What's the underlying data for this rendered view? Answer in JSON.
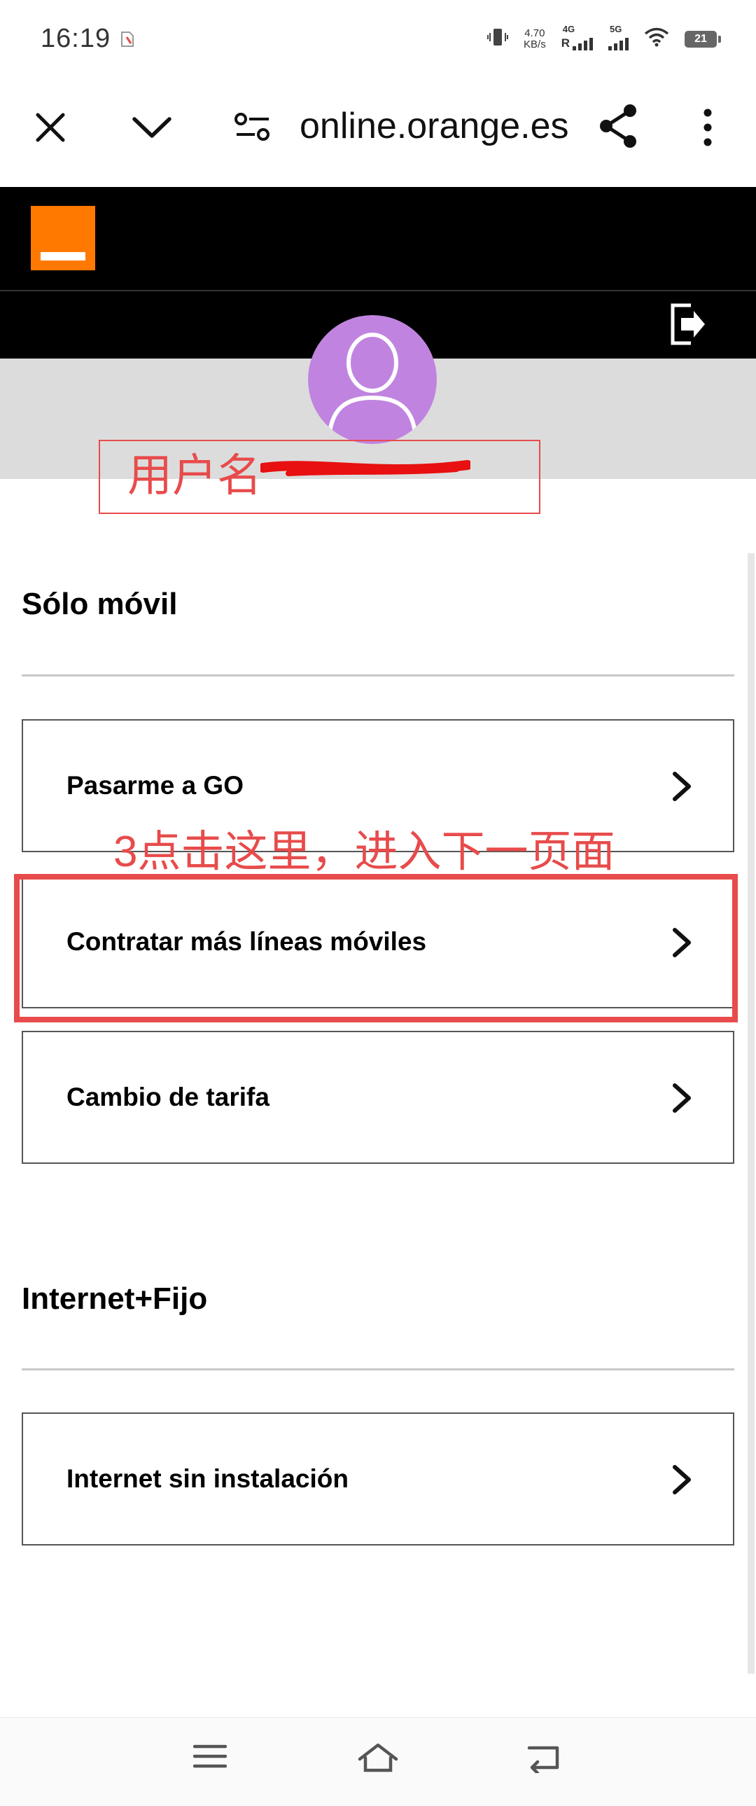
{
  "status_bar": {
    "time": "16:19",
    "net_speed_value": "4.70",
    "net_speed_unit": "KB/s",
    "signal1_tag": "4G",
    "signal1_roaming": "R",
    "signal2_tag": "5G",
    "battery_level": "21"
  },
  "browser": {
    "url_text": "online.orange.es"
  },
  "profile": {
    "username_annotation": "用户名"
  },
  "sections": {
    "solo_movil": {
      "title": "Sólo móvil",
      "items": [
        {
          "label": "Pasarme a GO"
        },
        {
          "label": "Contratar más líneas móviles"
        },
        {
          "label": "Cambio de tarifa"
        }
      ]
    },
    "internet_fijo": {
      "title": "Internet+Fijo",
      "items": [
        {
          "label": "Internet sin instalación"
        }
      ]
    }
  },
  "annotation": {
    "step_text": "3点击这里，进入下一页面",
    "color": "#e84b4b"
  },
  "colors": {
    "brand_orange": "#ff7900",
    "header_bg": "#000000",
    "avatar_bg": "#c084e0"
  }
}
